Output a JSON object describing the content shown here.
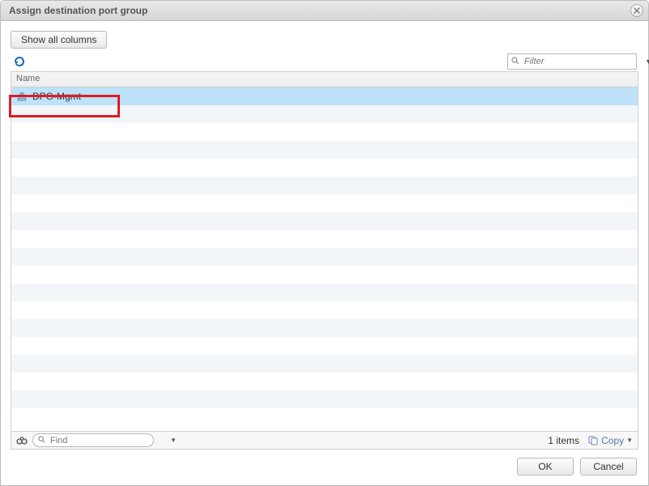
{
  "dialog": {
    "title": "Assign destination port group"
  },
  "toolbar": {
    "show_all_columns": "Show all columns",
    "filter_placeholder": "Filter"
  },
  "table": {
    "column_header": "Name",
    "rows": [
      {
        "name": "DPG-Mgmt",
        "selected": true
      }
    ]
  },
  "statusbar": {
    "find_placeholder": "Find",
    "item_count_text": "1 items",
    "copy_label": "Copy"
  },
  "footer": {
    "ok": "OK",
    "cancel": "Cancel"
  }
}
